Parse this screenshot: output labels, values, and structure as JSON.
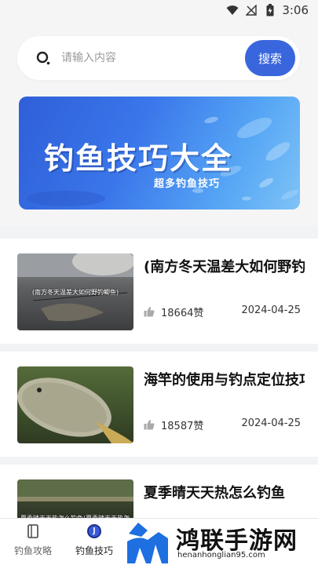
{
  "status_bar": {
    "time": "3:06",
    "icons": [
      "wifi-icon",
      "signal-off-icon",
      "battery-charging-icon"
    ]
  },
  "search": {
    "placeholder": "请输入内容",
    "button_label": "搜索"
  },
  "banner": {
    "title": "钓鱼技巧大全",
    "subtitle": "超多钓鱼技巧"
  },
  "articles": [
    {
      "title": "(南方冬天温差大如何野钓鲫鱼)",
      "thumb_caption": "(南方冬天温差大如何野钓鲫鱼)",
      "likes": "18664赞",
      "date": "2024-04-25"
    },
    {
      "title": "海竿的使用与钓点定位技巧",
      "thumb_caption": "",
      "likes": "18587赞",
      "date": "2024-04-25"
    },
    {
      "title": "夏季晴天天热怎么钓鱼",
      "thumb_caption": "夏季晴天天热怎么钓鱼(夏季晴天天热怎么钓鱼)",
      "likes": "",
      "date": ""
    }
  ],
  "bottom_nav": [
    {
      "label": "钓鱼攻略",
      "icon": "book-icon",
      "active": false
    },
    {
      "label": "钓鱼技巧",
      "icon": "fishing-tips-icon",
      "active": true
    }
  ],
  "watermark": {
    "text": "鸿联手游网",
    "url": "henanhonglian95.com"
  },
  "colors": {
    "accent": "#3a66dd",
    "background": "#f2f3f5",
    "card": "#ffffff"
  }
}
